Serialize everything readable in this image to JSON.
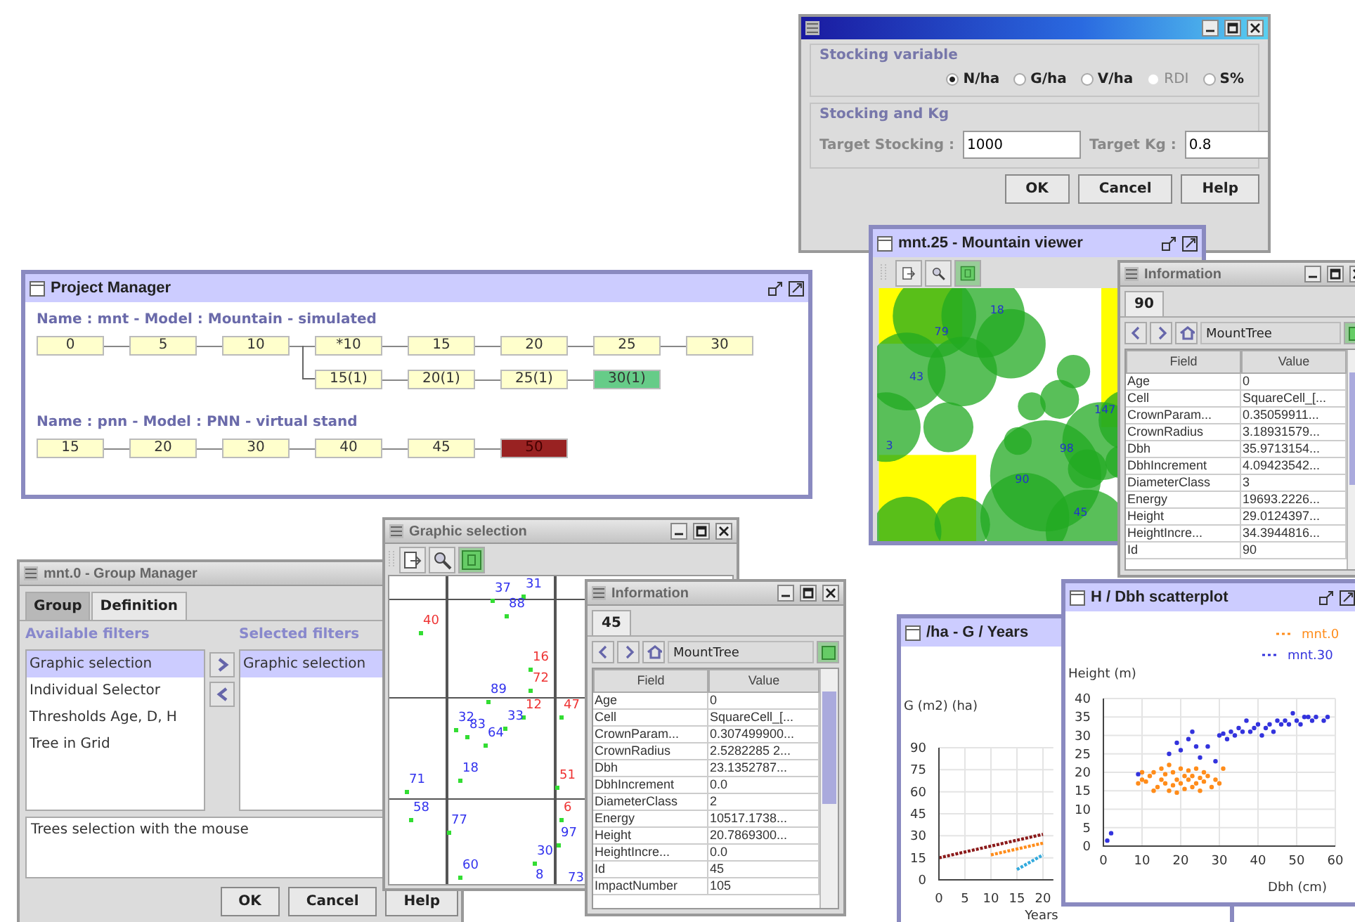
{
  "stocking_dialog": {
    "groups": [
      {
        "kind": "radios",
        "title": "Stocking variable",
        "radios": [
          {
            "label": "N/ha",
            "selected": true,
            "disabled": false
          },
          {
            "label": "G/ha",
            "selected": false,
            "disabled": false
          },
          {
            "label": "V/ha",
            "selected": false,
            "disabled": false
          },
          {
            "label": "RDI",
            "selected": false,
            "disabled": true
          },
          {
            "label": "S%",
            "selected": false,
            "disabled": false
          }
        ]
      },
      {
        "kind": "fields",
        "title": "Stocking and Kg",
        "fields": [
          {
            "label": "Target Stocking :",
            "value": "1000"
          },
          {
            "label": "Target Kg :",
            "value": "0.8"
          }
        ]
      }
    ],
    "buttons": [
      "OK",
      "Cancel",
      "Help"
    ]
  },
  "mountain_viewer": {
    "title": "mnt.25 - Mountain viewer",
    "tree_labels": [
      "18",
      "79",
      "43",
      "3",
      "147",
      "98",
      "90",
      "45"
    ]
  },
  "info_windows": [
    {
      "title": "Information",
      "tab": "90",
      "class_name": "MountTree",
      "columns": [
        "Field",
        "Value"
      ],
      "rows": [
        [
          "Age",
          "0"
        ],
        [
          "Cell",
          "SquareCell_[..."
        ],
        [
          "CrownParam...",
          "0.35059911..."
        ],
        [
          "CrownRadius",
          "3.18931579..."
        ],
        [
          "Dbh",
          "35.9713154..."
        ],
        [
          "DbhIncrement",
          "4.09423542..."
        ],
        [
          "DiameterClass",
          "3"
        ],
        [
          "Energy",
          "19693.2226..."
        ],
        [
          "Height",
          "29.0124397..."
        ],
        [
          "HeightIncre...",
          "34.3944816..."
        ],
        [
          "Id",
          "90"
        ]
      ]
    },
    {
      "title": "Information",
      "tab": "45",
      "class_name": "MountTree",
      "columns": [
        "Field",
        "Value"
      ],
      "rows": [
        [
          "Age",
          "0"
        ],
        [
          "Cell",
          "SquareCell_[..."
        ],
        [
          "CrownParam...",
          "0.307499900..."
        ],
        [
          "CrownRadius",
          "2.5282285 2..."
        ],
        [
          "Dbh",
          "23.1352787..."
        ],
        [
          "DbhIncrement",
          "0.0"
        ],
        [
          "DiameterClass",
          "2"
        ],
        [
          "Energy",
          "10517.1738..."
        ],
        [
          "Height",
          "20.7869300..."
        ],
        [
          "HeightIncre...",
          "0.0"
        ],
        [
          "Id",
          "45"
        ],
        [
          "ImpactNumber",
          "105"
        ]
      ]
    }
  ],
  "project_manager": {
    "title": "Project Manager",
    "projects": [
      {
        "header": "Name : mnt - Model : Mountain - simulated",
        "steps": [
          {
            "label": "0",
            "current": false,
            "error": false
          },
          {
            "label": "5",
            "current": false,
            "error": false
          },
          {
            "label": "10",
            "current": false,
            "error": false,
            "branch": [
              {
                "label": "15(1)",
                "current": false,
                "error": false
              },
              {
                "label": "20(1)",
                "current": false,
                "error": false
              },
              {
                "label": "25(1)",
                "current": false,
                "error": false
              },
              {
                "label": "30(1)",
                "current": true,
                "error": false
              }
            ]
          },
          {
            "label": "*10",
            "current": false,
            "error": false
          },
          {
            "label": "15",
            "current": false,
            "error": false
          },
          {
            "label": "20",
            "current": false,
            "error": false
          },
          {
            "label": "25",
            "current": false,
            "error": false
          },
          {
            "label": "30",
            "current": false,
            "error": false
          }
        ]
      },
      {
        "header": "Name : pnn - Model : PNN - virtual stand",
        "steps": [
          {
            "label": "15",
            "current": false,
            "error": false
          },
          {
            "label": "20",
            "current": false,
            "error": false
          },
          {
            "label": "30",
            "current": false,
            "error": false
          },
          {
            "label": "40",
            "current": false,
            "error": false
          },
          {
            "label": "45",
            "current": false,
            "error": false
          },
          {
            "label": "50",
            "current": false,
            "error": true
          }
        ]
      }
    ]
  },
  "group_manager": {
    "title": "mnt.0 - Group Manager",
    "tabs": [
      {
        "label": "Group",
        "selected": false
      },
      {
        "label": "Definition",
        "selected": true
      }
    ],
    "available_title": "Available filters",
    "available": [
      {
        "label": "Graphic selection",
        "selected": true
      },
      {
        "label": "Individual Selector",
        "selected": false
      },
      {
        "label": "Thresholds Age, D, H",
        "selected": false
      },
      {
        "label": "Tree in Grid",
        "selected": false
      }
    ],
    "selected_title": "Selected filters",
    "selected_filters": [
      {
        "label": "Graphic selection",
        "selected": true
      }
    ],
    "description": "Trees selection with the mouse",
    "buttons": [
      "OK",
      "Cancel",
      "Help"
    ]
  },
  "graphic_selection": {
    "title": "Graphic selection",
    "trees": [
      {
        "label": "37",
        "color": "#3333ee"
      },
      {
        "label": "31",
        "color": "#3333ee"
      },
      {
        "label": "88",
        "color": "#3333ee"
      },
      {
        "label": "40",
        "color": "#ee3333"
      },
      {
        "label": "16",
        "color": "#ee3333"
      },
      {
        "label": "72",
        "color": "#ee3333"
      },
      {
        "label": "89",
        "color": "#3333ee"
      },
      {
        "label": "12",
        "color": "#ee3333"
      },
      {
        "label": "47",
        "color": "#ee3333"
      },
      {
        "label": "32",
        "color": "#3333ee"
      },
      {
        "label": "33",
        "color": "#3333ee"
      },
      {
        "label": "83",
        "color": "#3333ee"
      },
      {
        "label": "64",
        "color": "#3333ee"
      },
      {
        "label": "18",
        "color": "#3333ee"
      },
      {
        "label": "71",
        "color": "#3333ee"
      },
      {
        "label": "51",
        "color": "#ee3333"
      },
      {
        "label": "58",
        "color": "#3333ee"
      },
      {
        "label": "6",
        "color": "#ee3333"
      },
      {
        "label": "77",
        "color": "#3333ee"
      },
      {
        "label": "97",
        "color": "#3333ee"
      },
      {
        "label": "30",
        "color": "#3333ee"
      },
      {
        "label": "60",
        "color": "#3333ee"
      },
      {
        "label": "8",
        "color": "#3333ee"
      },
      {
        "label": "73",
        "color": "#3333ee"
      }
    ]
  },
  "g_chart": {
    "title": "/ha - G / Years",
    "chart_data": {
      "type": "line",
      "xlabel": "Years",
      "ylabel": "G (m2) (ha)",
      "x": [
        0,
        5,
        10,
        15,
        20
      ],
      "xlim": [
        0,
        22
      ],
      "ylim": [
        0,
        90
      ],
      "xticks": [
        {
          "value": 0,
          "label": "0"
        },
        {
          "value": 5,
          "label": "5"
        },
        {
          "value": 10,
          "label": "10"
        },
        {
          "value": 15,
          "label": "15"
        },
        {
          "value": 20,
          "label": "20"
        }
      ],
      "yticks": [
        {
          "value": 0,
          "label": "0"
        },
        {
          "value": 15,
          "label": "15"
        },
        {
          "value": 30,
          "label": "30"
        },
        {
          "value": 45,
          "label": "45"
        },
        {
          "value": 60,
          "label": "60"
        },
        {
          "value": 75,
          "label": "75"
        },
        {
          "value": 90,
          "label": "90"
        }
      ],
      "grid": true,
      "series": [
        {
          "color": "#8b1a1a",
          "line_style": "dotted",
          "values": [
            15,
            19,
            23,
            27,
            31
          ]
        },
        {
          "color": "#ff8c1a",
          "line_style": "dotted",
          "values": [
            null,
            null,
            17,
            21,
            25
          ]
        },
        {
          "color": "#33aadd",
          "line_style": "dotted",
          "values": [
            null,
            null,
            null,
            7,
            17
          ]
        }
      ]
    }
  },
  "scatter_chart": {
    "title": "H / Dbh scatterplot",
    "chart_data": {
      "type": "scatter",
      "xlabel": "Dbh (cm)",
      "ylabel": "Height (m)",
      "xlim": [
        0,
        60
      ],
      "ylim": [
        0,
        40
      ],
      "xticks": [
        {
          "value": 0,
          "label": "0"
        },
        {
          "value": 10,
          "label": "10"
        },
        {
          "value": 20,
          "label": "20"
        },
        {
          "value": 30,
          "label": "30"
        },
        {
          "value": 40,
          "label": "40"
        },
        {
          "value": 50,
          "label": "50"
        },
        {
          "value": 60,
          "label": "60"
        }
      ],
      "yticks": [
        {
          "value": 0,
          "label": "0"
        },
        {
          "value": 5,
          "label": "5"
        },
        {
          "value": 10,
          "label": "10"
        },
        {
          "value": 15,
          "label": "15"
        },
        {
          "value": 20,
          "label": "20"
        },
        {
          "value": 25,
          "label": "25"
        },
        {
          "value": 30,
          "label": "30"
        },
        {
          "value": 35,
          "label": "35"
        },
        {
          "value": 40,
          "label": "40"
        }
      ],
      "grid": true,
      "legend": true,
      "series": [
        {
          "name": "mnt.0",
          "color": "#ff8c1a",
          "x": [
            9,
            10,
            10,
            11,
            12,
            13,
            13,
            14,
            15,
            15,
            16,
            16,
            17,
            17,
            18,
            18,
            19,
            19,
            20,
            20,
            21,
            21,
            22,
            22,
            23,
            23,
            24,
            24,
            25,
            25,
            26,
            26,
            27,
            28,
            29,
            31,
            30
          ],
          "values": [
            17,
            18,
            20,
            17.5,
            19,
            15,
            20,
            16,
            18,
            21,
            17,
            19.5,
            15,
            22,
            16.5,
            20,
            18,
            14.5,
            17,
            21,
            19,
            15.5,
            18,
            20.5,
            16,
            19,
            21,
            17,
            18.5,
            15,
            20,
            17.5,
            19,
            16,
            18,
            21,
            17
          ]
        },
        {
          "name": "mnt.30",
          "color": "#3333dd",
          "x": [
            1,
            2,
            9,
            17,
            19,
            20,
            22,
            23,
            24,
            25,
            27,
            29,
            30,
            31,
            32,
            33,
            34,
            35,
            36,
            37,
            38,
            39,
            40,
            41,
            42,
            43,
            44,
            45,
            46,
            47,
            48,
            49,
            50,
            51,
            52,
            53,
            54,
            55,
            57,
            58
          ],
          "values": [
            1.5,
            3.5,
            19.5,
            25,
            28,
            26,
            29,
            31,
            27,
            24,
            27,
            23,
            30,
            30.5,
            29,
            31,
            30,
            32,
            31,
            34,
            31,
            32,
            33,
            30,
            32,
            33,
            31,
            34,
            33,
            34,
            33,
            36,
            34,
            33,
            35,
            35,
            34,
            35,
            34,
            35
          ]
        }
      ]
    }
  }
}
